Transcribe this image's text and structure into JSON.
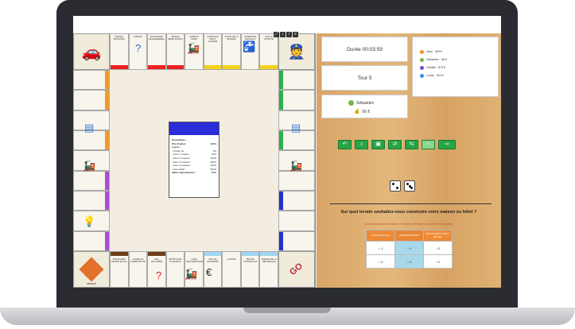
{
  "timer": "Durée 00:03:59",
  "turn": "Tour 5",
  "current_player": {
    "name": "Sébastien",
    "money": "56 €"
  },
  "players": [
    {
      "name": "Jean",
      "money": "409 €",
      "color": "#f0932b"
    },
    {
      "name": "Sébastien",
      "money": "56 €",
      "color": "#7ab648"
    },
    {
      "name": "Camille",
      "money": "874 €",
      "color": "#7a4cc2"
    },
    {
      "name": "Lucas",
      "money": "310 €",
      "color": "#3a8ee6"
    }
  ],
  "action_buttons": [
    "arrow-back-icon",
    "house-icon",
    "hotel-icon",
    "sell-icon",
    "mortgage-icon",
    "save-icon",
    "next-arrow-icon"
  ],
  "dice": [
    2,
    3
  ],
  "question": "Sur quel terrain souhaitez-vous construire votre maison ou hôtel ?",
  "subtext": "La construction de maisons et hôtels s'effectue de manière homogène",
  "build_table": {
    "headers": [
      "PLACE PIGALLE",
      "AVENUE MOZART",
      "BOULEVARD SAINT-MICHEL"
    ],
    "houses": [
      "1",
      "1",
      "0"
    ],
    "hotels": [
      "0",
      "0",
      "0"
    ]
  },
  "card": {
    "rows": [
      {
        "label": "Propriétaire :",
        "value": ""
      },
      {
        "label": "Prix d'achat :",
        "value": "120 €"
      },
      {
        "label": "Loyers :",
        "value": ""
      },
      {
        "label": "- Terrain nu :",
        "value": "8 €"
      },
      {
        "label": "- Avec 1 maison :",
        "value": "40 €"
      },
      {
        "label": "- Avec 2 maisons :",
        "value": "100 €"
      },
      {
        "label": "- Avec 3 maisons :",
        "value": "300 €"
      },
      {
        "label": "- Avec 4 maisons :",
        "value": "450 €"
      },
      {
        "label": "- Avec Hôtel :",
        "value": "600 €"
      },
      {
        "label": "Valeur hypothécaire :",
        "value": "60 €"
      }
    ]
  },
  "board": {
    "top": [
      {
        "name": "AVENUE MATIGNON",
        "band": "#e22"
      },
      {
        "name": "CHANCE",
        "band": ""
      },
      {
        "name": "BOULEVARD MALESHERBES",
        "band": "#e22"
      },
      {
        "name": "AVENUE HENRI-MARTIN",
        "band": "#e22"
      },
      {
        "name": "GARE DU NORD",
        "band": ""
      },
      {
        "name": "FAUBOURG SAINT-HONORÉ",
        "band": "#f2d21c"
      },
      {
        "name": "PLACE DE LA BOURSE",
        "band": "#f2d21c"
      },
      {
        "name": "COMPAGNIE DES EAUX",
        "band": ""
      },
      {
        "name": "RUE LA FAYETTE",
        "band": "#f2d21c"
      }
    ],
    "bottom": [
      {
        "name": "BOULEVARD DE BELLEVILLE",
        "band": "#6d3d1a"
      },
      {
        "name": "CAISSE DE COMMUNAUTÉ",
        "band": ""
      },
      {
        "name": "RUE LECOURBE",
        "band": "#6d3d1a"
      },
      {
        "name": "IMPÔTS SUR LE REVENU",
        "band": ""
      },
      {
        "name": "GARE MONTPARNASSE",
        "band": ""
      },
      {
        "name": "RUE DE VAUGIRARD",
        "band": "#9fd6ee"
      },
      {
        "name": "CHANCE",
        "band": ""
      },
      {
        "name": "RUE DE COURCELLES",
        "band": "#9fd6ee"
      },
      {
        "name": "AVENUE DE LA RÉPUBLIQUE",
        "band": "#9fd6ee"
      }
    ],
    "prison_label": "PRISON",
    "go_label": "GO"
  }
}
